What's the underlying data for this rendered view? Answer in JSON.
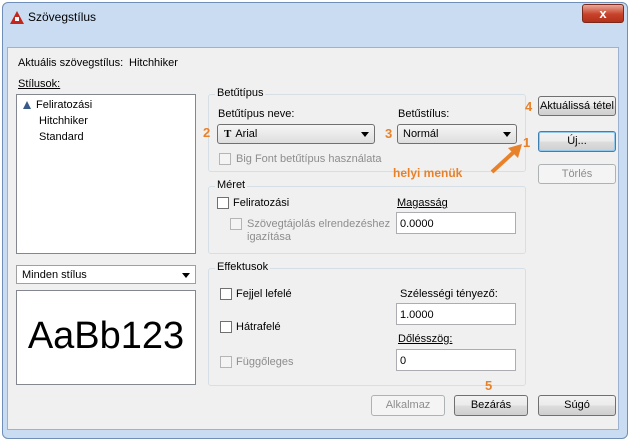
{
  "window": {
    "title": "Szövegstílus",
    "close_glyph": "x"
  },
  "current_style": {
    "label": "Aktuális szövegstílus:",
    "value": "Hitchhiker"
  },
  "styles": {
    "label": "Stílusok:",
    "items": [
      {
        "label": "Feliratozási",
        "icon": "annotative-icon"
      },
      {
        "label": "Hitchhiker",
        "icon": ""
      },
      {
        "label": "Standard",
        "icon": ""
      }
    ],
    "filter": "Minden stílus"
  },
  "preview": {
    "text": "AaBb123"
  },
  "font": {
    "group": "Betűtípus",
    "name_label": "Betűtípus neve:",
    "name_value": "Arial",
    "name_icon": "truetype-icon",
    "style_label": "Betűstílus:",
    "style_value": "Normál",
    "bigfont_label": "Big Font betűtípus használata"
  },
  "size": {
    "group": "Méret",
    "annotative_label": "Feliratozási",
    "match_label_line1": "Szövegtájolás elrendezéshez",
    "match_label_line2": "igazítása",
    "height_label": "Magasság",
    "height_value": "0.0000"
  },
  "effects": {
    "group": "Effektusok",
    "upside_down": "Fejjel lefelé",
    "backwards": "Hátrafelé",
    "vertical": "Függőleges",
    "width_label": "Szélességi tényező:",
    "width_value": "1.0000",
    "oblique_label": "Dőlésszög:",
    "oblique_value": "0"
  },
  "buttons": {
    "set_current": "Aktuálissá tétel",
    "new": "Új...",
    "delete": "Törlés",
    "apply": "Alkalmaz",
    "close": "Bezárás",
    "help": "Súgó"
  },
  "annotations": {
    "n1": "1",
    "n2": "2",
    "n3": "3",
    "n4": "4",
    "n5": "5",
    "context_menus": "helyi menük",
    "color": "#e8822a"
  },
  "colors": {
    "accent": "#e8822a",
    "title_close": "#c7422a",
    "frame": "#c9dcf1"
  }
}
